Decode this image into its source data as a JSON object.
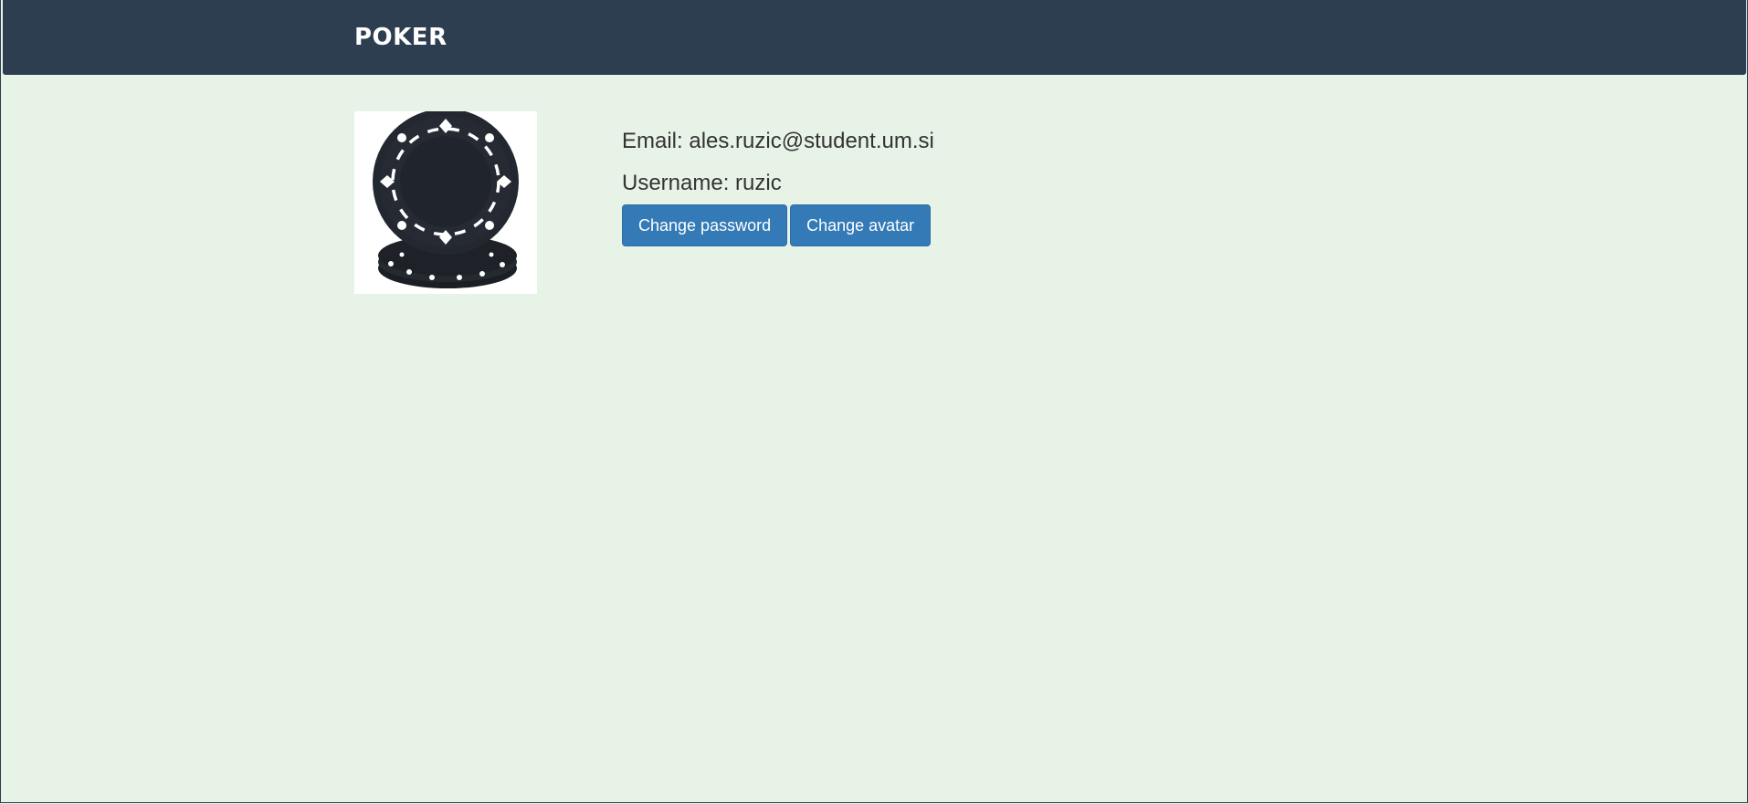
{
  "navbar": {
    "brand": "POKER"
  },
  "profile": {
    "avatar_icon": "poker-chip-icon",
    "email_label": "Email:",
    "email_value": "ales.ruzic@student.um.si",
    "username_label": "Username:",
    "username_value": "ruzic"
  },
  "actions": {
    "change_password": "Change password",
    "change_avatar": "Change avatar"
  },
  "colors": {
    "navbar": "#2c3e50",
    "background": "#e7f3e7",
    "button": "#337ab7"
  }
}
